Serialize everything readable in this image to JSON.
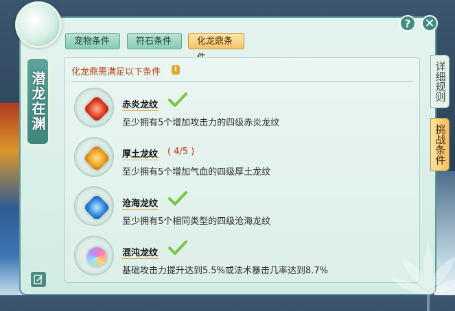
{
  "window": {
    "title": "潜龙在渊",
    "help_label": "?",
    "close_label": "✕",
    "edit_icon": "edit-icon"
  },
  "tabs": [
    {
      "label": "宠物条件",
      "active": false
    },
    {
      "label": "符石条件",
      "active": false
    },
    {
      "label": "化龙鼎条件",
      "active": true
    }
  ],
  "side_tabs": [
    {
      "label": "详细规则",
      "active": false
    },
    {
      "label": "挑战条件",
      "active": true
    }
  ],
  "panel": {
    "title": "化龙鼎需满足以下条件",
    "info_icon": "i"
  },
  "conditions": [
    {
      "name": "赤炎龙纹",
      "progress": "",
      "completed": true,
      "gem": "red-gem",
      "description": "至少拥有5个增加攻击力的四级赤炎龙纹"
    },
    {
      "name": "厚土龙纹",
      "progress": "( 4/5 )",
      "completed": false,
      "gem": "orange-gem",
      "description": "至少拥有5个增加气血的四级厚土龙纹"
    },
    {
      "name": "沧海龙纹",
      "progress": "",
      "completed": true,
      "gem": "blue-gem",
      "description": "至少拥有5个相同类型的四级沧海龙纹"
    },
    {
      "name": "混沌龙纹",
      "progress": "",
      "completed": true,
      "gem": "rainbow-gem",
      "description": "基础攻击力提升达到5.5%或法术暴击几率达到8.7%"
    }
  ],
  "colors": {
    "accent_teal": "#3f8a83",
    "active_tab": "#f3c46a",
    "title_red": "#c0421c",
    "check_green": "#7cc243"
  }
}
